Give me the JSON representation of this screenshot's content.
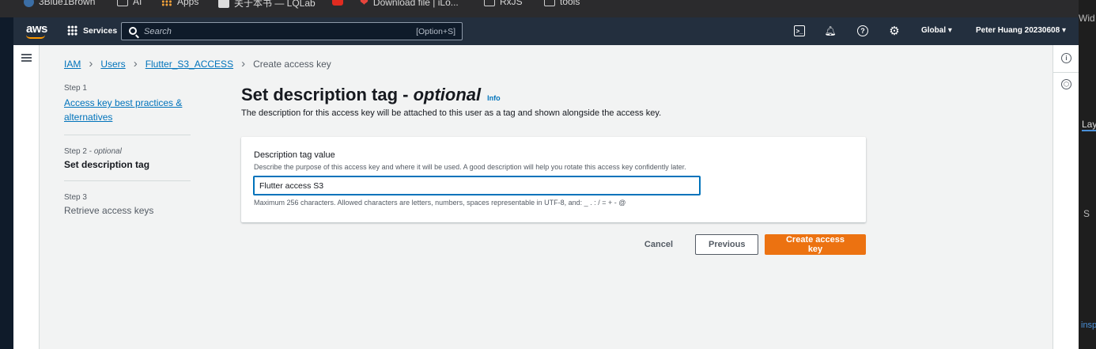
{
  "bookmarks": [
    {
      "label": "3Blue1Brown",
      "icon": "globe-icon"
    },
    {
      "label": "AI",
      "icon": "folder-icon"
    },
    {
      "label": "Apps",
      "icon": "apps-grid-icon"
    },
    {
      "label": "关于本书 — LQLab",
      "icon": "page-icon"
    },
    {
      "label": "",
      "icon": "youtube-icon"
    },
    {
      "label": "Download file | iLo...",
      "icon": "heart-icon"
    },
    {
      "label": "RxJS",
      "icon": "folder-icon"
    },
    {
      "label": "tools",
      "icon": "folder-icon"
    }
  ],
  "topnav": {
    "logo": "aws",
    "services_label": "Services",
    "search_placeholder": "Search",
    "search_shortcut": "[Option+S]",
    "region": "Global ▾",
    "account": "Peter Huang 20230608 ▾",
    "colors": {
      "bar": "#232f3e",
      "accent": "#ff9900"
    }
  },
  "breadcrumb": {
    "items": [
      "IAM",
      "Users",
      "Flutter_S3_ACCESS"
    ],
    "current": "Create access key"
  },
  "steps": [
    {
      "num": "Step 1",
      "label": "Access key best practices & alternatives"
    },
    {
      "num": "Step 2 - ",
      "num_suffix": "optional",
      "label": "Set description tag"
    },
    {
      "num": "Step 3",
      "label": "Retrieve access keys"
    }
  ],
  "page": {
    "title": "Set description tag - ",
    "title_suffix": "optional",
    "info": "Info",
    "description": "The description for this access key will be attached to this user as a tag and shown alongside the access key."
  },
  "form": {
    "label": "Description tag value",
    "help": "Describe the purpose of this access key and where it will be used. A good description will help you rotate this access key confidently later.",
    "value": "Flutter access S3",
    "constraint": "Maximum 256 characters. Allowed characters are letters, numbers, spaces representable in UTF-8, and: _ . : / = + - @"
  },
  "actions": {
    "cancel": "Cancel",
    "previous": "Previous",
    "create": "Create access key",
    "primary_color": "#ec7211"
  },
  "side_window": {
    "texts": [
      "Wid",
      "Lay",
      "S",
      "insp"
    ]
  }
}
